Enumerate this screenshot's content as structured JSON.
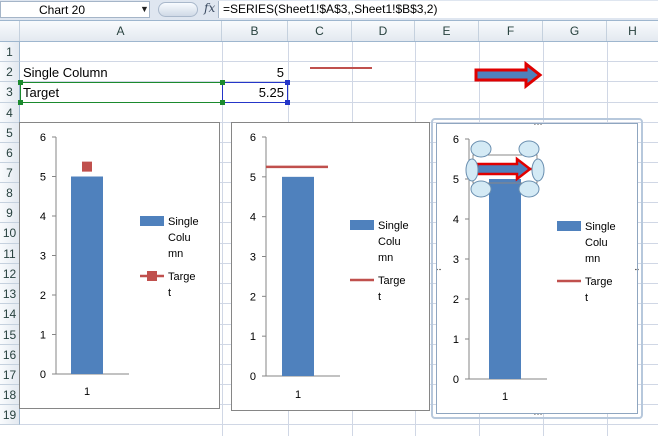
{
  "formula_bar": {
    "name_box": "Chart 20",
    "fx_icon": "fx-icon",
    "formula": "=SERIES(Sheet1!$A$3,,Sheet1!$B$3,2)"
  },
  "columns": [
    "A",
    "B",
    "C",
    "D",
    "E",
    "F",
    "G",
    "H"
  ],
  "rows": [
    "1",
    "2",
    "3",
    "4",
    "5",
    "6",
    "7",
    "8",
    "9",
    "10",
    "11",
    "12",
    "13",
    "14",
    "15",
    "16",
    "17",
    "18",
    "19"
  ],
  "cells": {
    "a2": "Single Column",
    "b2": "5",
    "a3": "Target",
    "b3": "5.25"
  },
  "colors": {
    "series_bar": "#4f81bd",
    "target": "#c0504d",
    "selection_blue": "#2536c8",
    "selection_green": "#1b8a2e"
  },
  "chart_data": [
    {
      "type": "bar",
      "categories": [
        "1"
      ],
      "series": [
        {
          "name": "Single Column",
          "type": "bar",
          "values": [
            5
          ]
        },
        {
          "name": "Target",
          "type": "scatter",
          "marker": "square",
          "values": [
            5.25
          ]
        }
      ],
      "ylim": [
        0,
        6
      ],
      "yticks": [
        "0",
        "1",
        "2",
        "3",
        "4",
        "5",
        "6"
      ],
      "legend_entries": [
        [
          "Single",
          "Colu",
          "mn"
        ],
        [
          "Targe",
          "t"
        ]
      ],
      "legend_position": "right"
    },
    {
      "type": "bar",
      "categories": [
        "1"
      ],
      "series": [
        {
          "name": "Single Column",
          "type": "bar",
          "values": [
            5
          ]
        },
        {
          "name": "Target",
          "type": "line",
          "values": [
            5.25
          ]
        }
      ],
      "ylim": [
        0,
        6
      ],
      "yticks": [
        "0",
        "1",
        "2",
        "3",
        "4",
        "5",
        "6"
      ],
      "legend_entries": [
        [
          "Single",
          "Colu",
          "mn"
        ],
        [
          "Targe",
          "t"
        ]
      ],
      "legend_position": "right"
    },
    {
      "type": "bar",
      "categories": [
        "1"
      ],
      "series": [
        {
          "name": "Single Column",
          "type": "bar",
          "values": [
            5
          ]
        },
        {
          "name": "Target",
          "type": "line",
          "values": [
            5.25
          ],
          "selected": true
        }
      ],
      "ylim": [
        0,
        6
      ],
      "yticks": [
        "0",
        "1",
        "2",
        "3",
        "4",
        "5",
        "6"
      ],
      "legend_entries": [
        [
          "Single",
          "Colu",
          "mn"
        ],
        [
          "Targe",
          "t"
        ]
      ],
      "legend_position": "right"
    }
  ]
}
